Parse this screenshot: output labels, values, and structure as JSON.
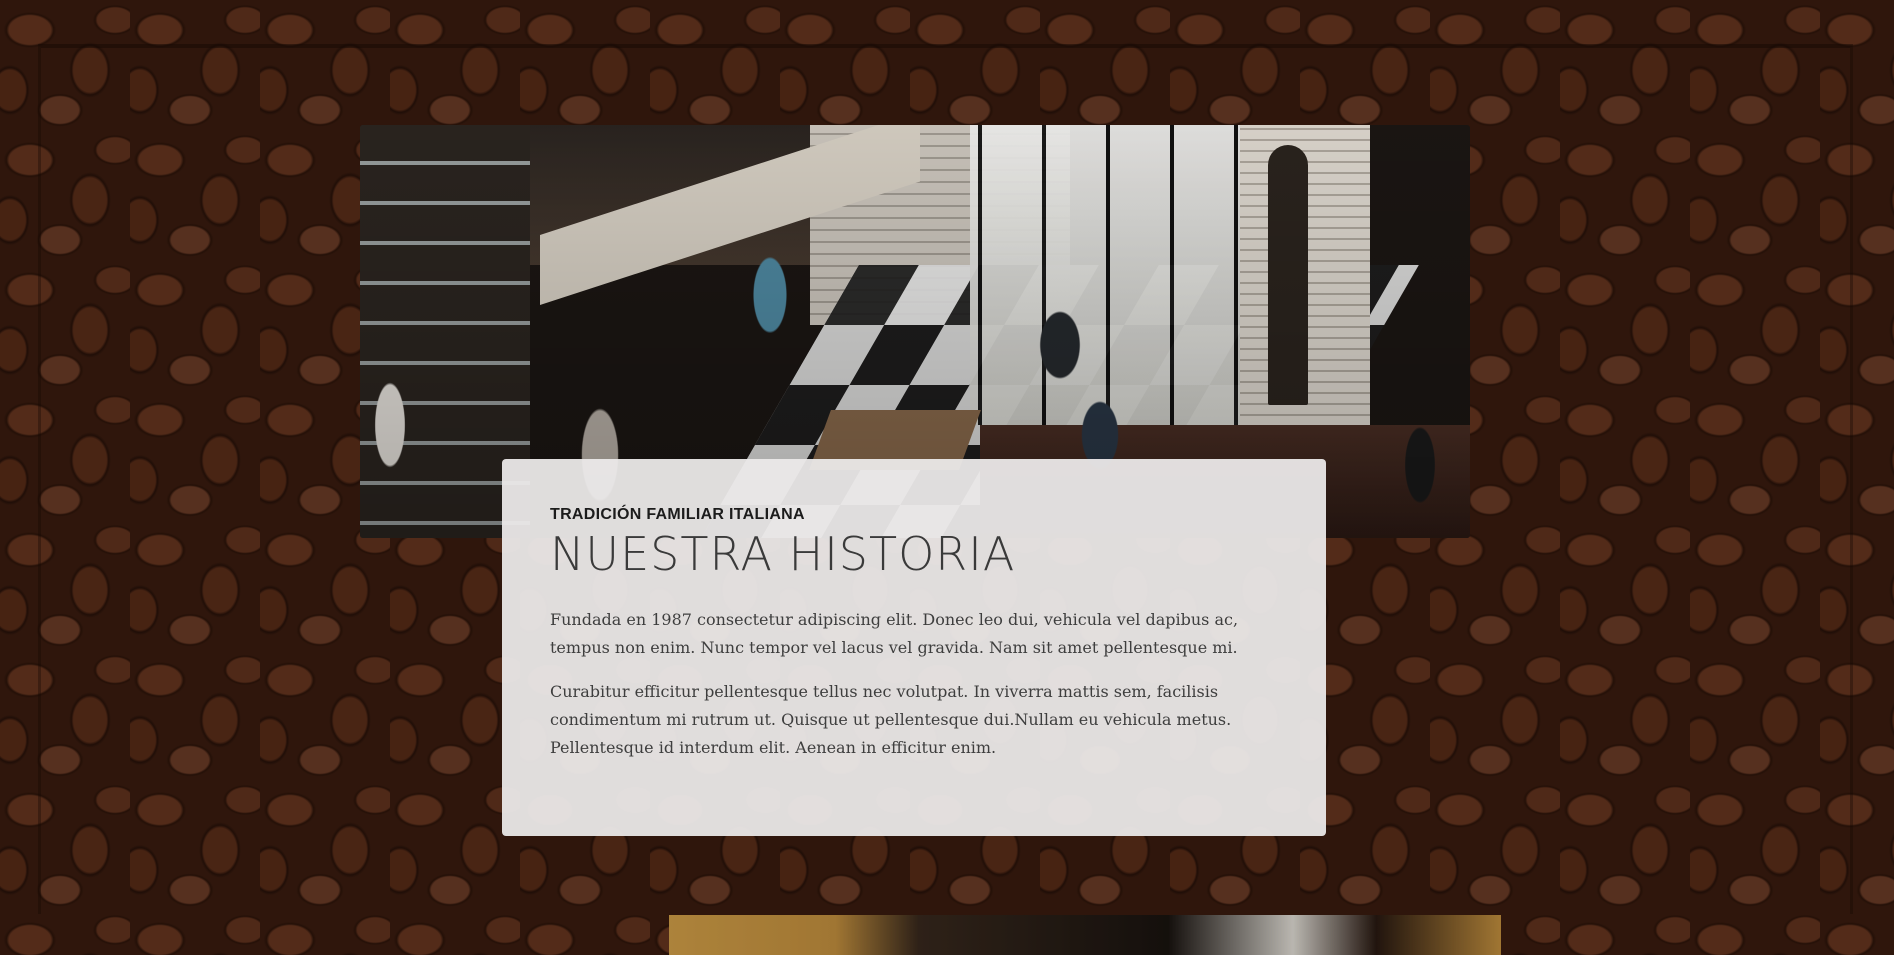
{
  "about": {
    "eyebrow": "Tradición familiar italiana",
    "title": "Nuestra historia",
    "paragraphs": [
      "Fundada en 1987 consectetur adipiscing elit. Donec leo dui, vehicula vel dapibus ac, tempus non enim. Nunc tempor vel lacus vel gravida. Nam sit amet pellentesque mi.",
      "Curabitur efficitur pellentesque tellus nec volutpat. In viverra mattis sem, facilisis condimentum mi rutrum ut. Quisque ut pellentesque dui.Nullam eu vehicula metus. Pellentesque id interdum elit. Aenean in efficitur enim."
    ],
    "image": "cafe-interior-photo"
  },
  "background": "coffee-beans-photo",
  "next_section": {
    "image": "coffee-photo"
  },
  "colors": {
    "card_bg": "#eceaea",
    "heading": "#3a3a3a",
    "eyebrow": "#1c1c1c",
    "body_text": "#3e3e3e",
    "background": "#3a1d10"
  }
}
